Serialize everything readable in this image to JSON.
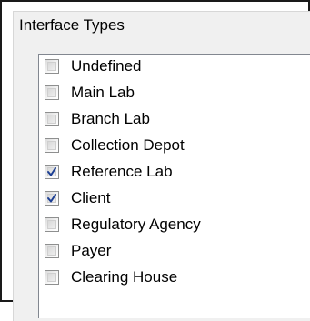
{
  "group": {
    "title": "Interface Types"
  },
  "interface_types": [
    {
      "label": "Undefined",
      "checked": false
    },
    {
      "label": "Main Lab",
      "checked": false
    },
    {
      "label": "Branch Lab",
      "checked": false
    },
    {
      "label": "Collection Depot",
      "checked": false
    },
    {
      "label": "Reference Lab",
      "checked": true
    },
    {
      "label": "Client",
      "checked": true
    },
    {
      "label": "Regulatory Agency",
      "checked": false
    },
    {
      "label": "Payer",
      "checked": false
    },
    {
      "label": "Clearing House",
      "checked": false
    }
  ],
  "colors": {
    "checkmark": "#1c3f94"
  }
}
